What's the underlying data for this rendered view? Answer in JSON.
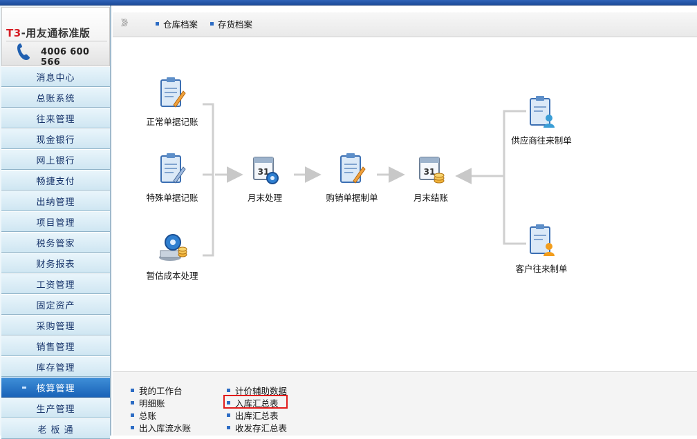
{
  "brand": {
    "title_prefix": "T3",
    "title_rest": "-用友通标准版",
    "phone": "4006 600 566"
  },
  "sidebar": {
    "items": [
      {
        "label": "消息中心"
      },
      {
        "label": "总账系统"
      },
      {
        "label": "往来管理"
      },
      {
        "label": "现金银行"
      },
      {
        "label": "网上银行"
      },
      {
        "label": "畅捷支付"
      },
      {
        "label": "出纳管理"
      },
      {
        "label": "项目管理"
      },
      {
        "label": "税务管家"
      },
      {
        "label": "财务报表"
      },
      {
        "label": "工资管理"
      },
      {
        "label": "固定资产"
      },
      {
        "label": "采购管理"
      },
      {
        "label": "销售管理"
      },
      {
        "label": "库存管理"
      },
      {
        "label": "核算管理",
        "active": true
      },
      {
        "label": "生产管理"
      },
      {
        "label": "老 板 通"
      }
    ]
  },
  "tabs": {
    "chevron": "》》",
    "items": [
      {
        "label": "仓库档案"
      },
      {
        "label": "存货档案"
      }
    ]
  },
  "flow": {
    "normal_post": "正常单据记账",
    "special_post": "特殊单据记账",
    "estimate": "暂估成本处理",
    "month_process": "月末处理",
    "purchase_sales": "购销单据制单",
    "month_close": "月末结账",
    "supplier": "供应商往来制单",
    "customer": "客户往来制单"
  },
  "reports": {
    "col1": [
      {
        "label": "我的工作台"
      },
      {
        "label": "明细账"
      },
      {
        "label": "总账"
      },
      {
        "label": "出入库流水账"
      }
    ],
    "col2": [
      {
        "label": "计价辅助数据"
      },
      {
        "label": "入库汇总表"
      },
      {
        "label": "出库汇总表"
      },
      {
        "label": "收发存汇总表"
      }
    ]
  },
  "colors": {
    "accent": "#1a63b8",
    "highlight": "#e21b1b",
    "nav_bg": "#cfe6f2"
  }
}
